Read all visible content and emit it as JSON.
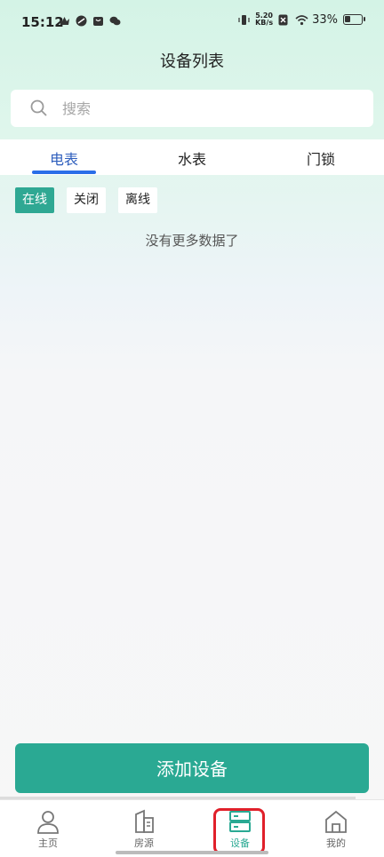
{
  "status_bar": {
    "time": "15:12",
    "net_speed_value": "5.20",
    "net_speed_unit": "KB/s",
    "battery": "33%",
    "battery_level": 0.33,
    "icons": [
      "crown-icon",
      "leaf-icon",
      "shopping-bag-icon",
      "wechat-icon",
      "vibrate-icon",
      "sim-x-icon",
      "wifi-icon",
      "battery-icon"
    ]
  },
  "header": {
    "title": "设备列表"
  },
  "search": {
    "placeholder": "搜索",
    "value": ""
  },
  "tabs": [
    {
      "label": "电表",
      "active": true
    },
    {
      "label": "水表",
      "active": false
    },
    {
      "label": "门锁",
      "active": false
    }
  ],
  "filters": [
    {
      "label": "在线",
      "active": true
    },
    {
      "label": "关闭",
      "active": false
    },
    {
      "label": "离线",
      "active": false
    }
  ],
  "list": {
    "empty_message": "没有更多数据了"
  },
  "actions": {
    "add_device": "添加设备"
  },
  "bottom_nav": [
    {
      "label": "主页",
      "icon": "person-icon",
      "active": false
    },
    {
      "label": "房源",
      "icon": "building-icon",
      "active": false
    },
    {
      "label": "设备",
      "icon": "device-icon",
      "active": true
    },
    {
      "label": "我的",
      "icon": "house-icon",
      "active": false
    }
  ],
  "colors": {
    "accent": "#2aa993",
    "tab_active": "#2f5fbd",
    "highlight": "#e0202a"
  }
}
